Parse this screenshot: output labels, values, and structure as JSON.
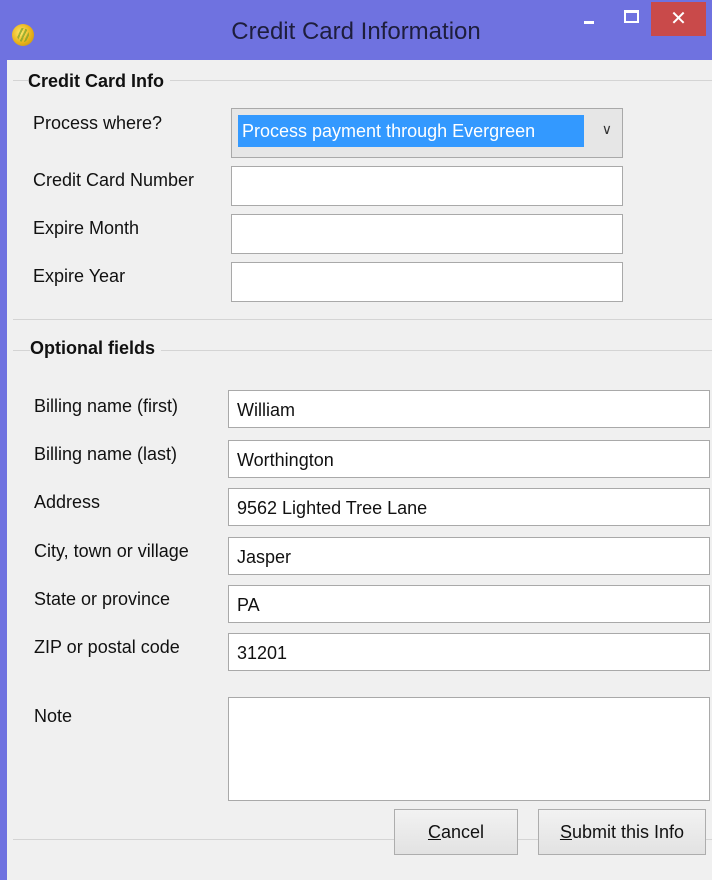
{
  "window": {
    "title": "Credit Card Information",
    "close_glyph": "✕",
    "icon": "evergreen-app-icon"
  },
  "credit_card_info": {
    "group_title": "Credit Card Info",
    "process_where_label": "Process where?",
    "process_where_value": "Process payment through Evergreen",
    "card_number_label": "Credit Card Number",
    "card_number_value": "",
    "expire_month_label": "Expire Month",
    "expire_month_value": "",
    "expire_year_label": "Expire Year",
    "expire_year_value": ""
  },
  "optional_fields": {
    "group_title": "Optional fields",
    "first_name_label": "Billing name (first)",
    "first_name_value": "William",
    "last_name_label": "Billing name (last)",
    "last_name_value": "Worthington",
    "address_label": "Address",
    "address_value": "9562 Lighted Tree Lane",
    "city_label": "City, town or village",
    "city_value": "Jasper",
    "state_label": "State or province",
    "state_value": "PA",
    "zip_label": "ZIP or postal code",
    "zip_value": "31201",
    "note_label": "Note",
    "note_value": ""
  },
  "buttons": {
    "cancel_mnemonic": "C",
    "cancel_rest": "ancel",
    "submit_mnemonic": "S",
    "submit_rest": "ubmit this Info"
  },
  "colors": {
    "title_bar": "#6f72e0",
    "close_button": "#c94a4a",
    "selection": "#3399ff"
  }
}
